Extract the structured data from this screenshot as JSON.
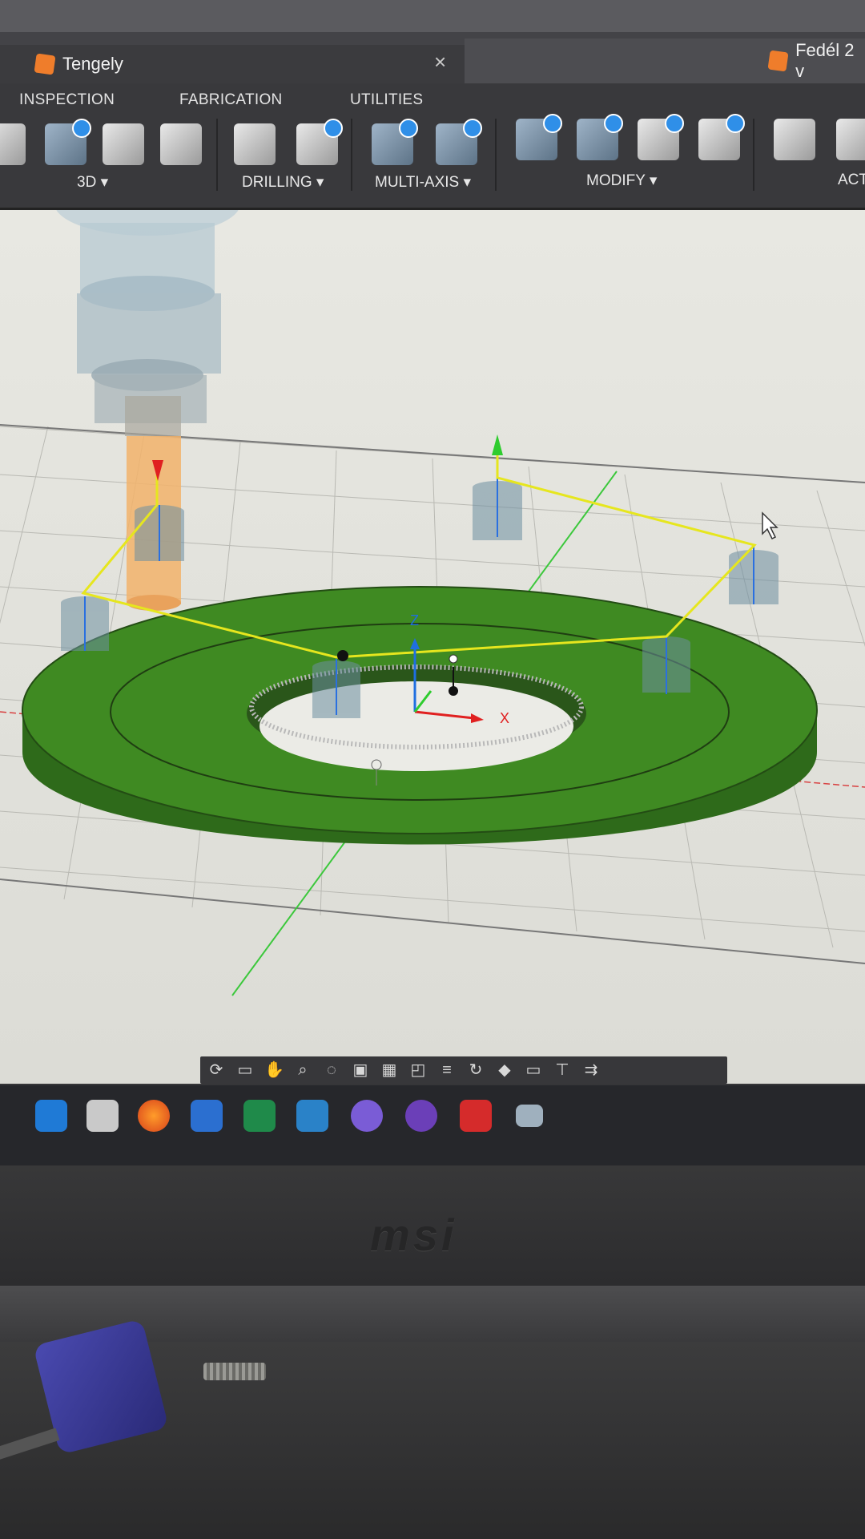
{
  "tabs": [
    {
      "label": "Tengely",
      "icon": "cube-icon",
      "active": true
    },
    {
      "label": "Fedél 2 v",
      "icon": "cube-icon",
      "active": false
    }
  ],
  "menus": [
    "INSPECTION",
    "FABRICATION",
    "UTILITIES"
  ],
  "tool_groups": [
    {
      "label": "3D ▾"
    },
    {
      "label": "DRILLING ▾"
    },
    {
      "label": "MULTI-AXIS ▾"
    },
    {
      "label": "MODIFY ▾"
    },
    {
      "label": "ACT"
    }
  ],
  "viewport": {
    "axis_x": "X",
    "axis_z": "Z",
    "colors": {
      "part": "#3f8a22",
      "toolpath": "#e6e61e",
      "tool": "#f2b36b",
      "axis_x": "#e02020",
      "axis_y": "#2ecc2e",
      "axis_z": "#1f6fe0"
    }
  },
  "navbar_icons": [
    "orbit-icon",
    "look-at-icon",
    "pan-icon",
    "zoom-icon",
    "fit-icon",
    "display-icon",
    "grid-icon",
    "snap-icon",
    "layout-icon",
    "rotate-icon",
    "view-cube-icon",
    "window-icon",
    "tool-icon",
    "arrows-icon"
  ],
  "taskbar_apps": [
    "vscode-icon",
    "snipping-tool-icon",
    "firefox-icon",
    "word-icon",
    "excel-icon",
    "ccleaner-icon",
    "viber-icon",
    "tor-icon",
    "acrobat-icon",
    "network-icon"
  ],
  "laptop_brand": "msi"
}
